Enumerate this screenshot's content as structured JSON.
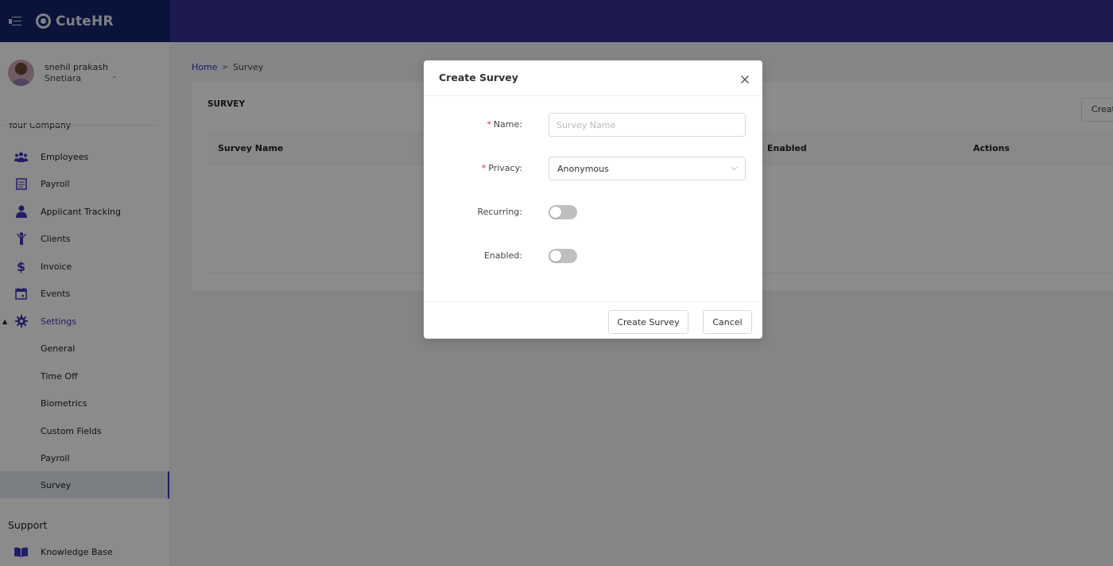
{
  "app": {
    "name": "CuteHR",
    "colors": {
      "topbar": "#342f8f",
      "brand_bg": "#13266b",
      "accent": "#3c35b8",
      "required": "#f5222d"
    }
  },
  "user": {
    "name": "snehil prakash",
    "org": "Snetiara"
  },
  "sidebar": {
    "section_title": "Your Company",
    "items": [
      {
        "label": "Employees",
        "icon": "users-icon"
      },
      {
        "label": "Payroll",
        "icon": "payroll-icon"
      },
      {
        "label": "Applicant Tracking",
        "icon": "applicant-icon"
      },
      {
        "label": "Clients",
        "icon": "client-icon"
      },
      {
        "label": "Invoice",
        "icon": "dollar-icon"
      },
      {
        "label": "Events",
        "icon": "calendar-icon"
      },
      {
        "label": "Settings",
        "icon": "gear-icon",
        "expanded": true
      }
    ],
    "settings_sub": [
      {
        "label": "General"
      },
      {
        "label": "Time Off"
      },
      {
        "label": "Biometrics"
      },
      {
        "label": "Custom Fields"
      },
      {
        "label": "Payroll"
      },
      {
        "label": "Survey",
        "active": true
      }
    ],
    "support_title": "Support",
    "support_items": [
      {
        "label": "Knowledge Base",
        "icon": "book-icon"
      }
    ]
  },
  "breadcrumb": {
    "home": "Home",
    "separator": ">",
    "current": "Survey"
  },
  "page": {
    "card_title": "SURVEY",
    "create_button": "Create Survey",
    "columns": [
      "Survey Name",
      "Enabled",
      "Actions"
    ]
  },
  "modal": {
    "title": "Create Survey",
    "fields": {
      "name": {
        "label": "Name",
        "required": true,
        "placeholder": "Survey Name",
        "value": ""
      },
      "privacy": {
        "label": "Privacy",
        "required": true,
        "value": "Anonymous"
      },
      "recurring": {
        "label": "Recurring",
        "value": false
      },
      "enabled": {
        "label": "Enabled",
        "value": false
      }
    },
    "colon": ":",
    "required_mark": "*",
    "create_label": "Create Survey",
    "cancel_label": "Cancel"
  }
}
